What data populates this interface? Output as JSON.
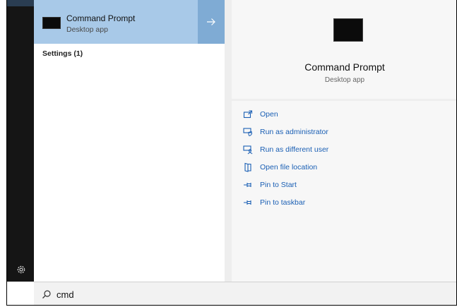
{
  "search": {
    "value": "cmd"
  },
  "results": {
    "best_match": {
      "title": "Command Prompt",
      "subtitle": "Desktop app"
    },
    "section_heading": "Settings (1)"
  },
  "detail": {
    "title": "Command Prompt",
    "subtitle": "Desktop app",
    "actions": [
      {
        "label": "Open",
        "icon": "open-icon"
      },
      {
        "label": "Run as administrator",
        "icon": "run-as-admin-icon"
      },
      {
        "label": "Run as different user",
        "icon": "run-as-user-icon"
      },
      {
        "label": "Open file location",
        "icon": "file-location-icon"
      },
      {
        "label": "Pin to Start",
        "icon": "pin-icon"
      },
      {
        "label": "Pin to taskbar",
        "icon": "pin-icon"
      }
    ]
  },
  "colors": {
    "accent_selected": "#a8c9e8",
    "accent_arrow": "#7fabd4",
    "link_blue": "#1a5fb4",
    "rail": "#151515"
  }
}
